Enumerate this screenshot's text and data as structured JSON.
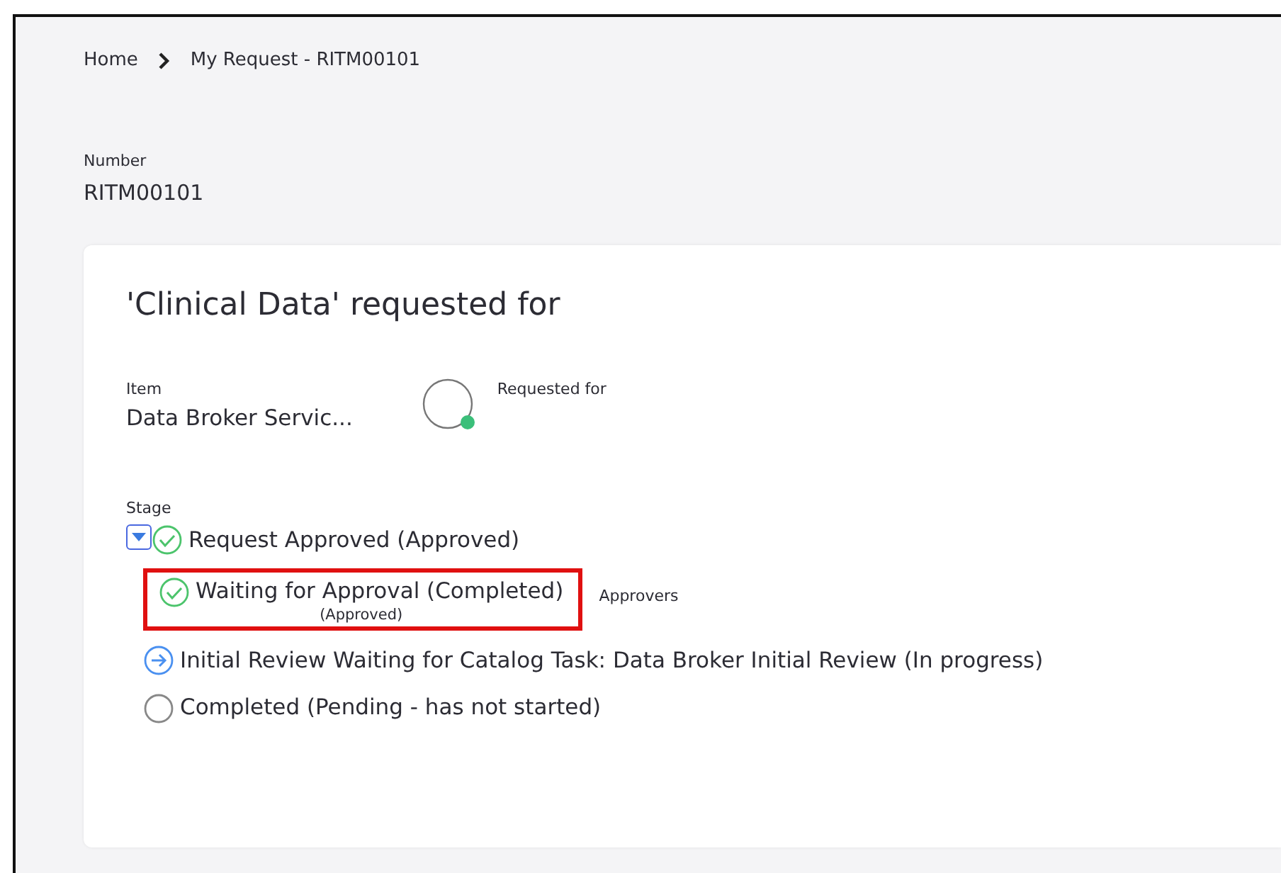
{
  "breadcrumb": [
    {
      "label": "Home"
    },
    {
      "label": "My Request - RITM00101"
    }
  ],
  "number": {
    "label": "Number",
    "value": "RITM00101"
  },
  "card": {
    "title": "'Clinical Data' requested for",
    "item": {
      "label": "Item",
      "value": "Data Broker Servic..."
    },
    "requested_for": {
      "label": "Requested for",
      "online": true
    },
    "stage": {
      "label": "Stage",
      "expanded": true,
      "stages": [
        {
          "kind": "approved",
          "text": "Request Approved (Approved)",
          "highlighted": false
        },
        {
          "kind": "approved",
          "text": "Waiting for Approval (Completed)",
          "subtext": "(Approved)",
          "side_label": "Approvers",
          "highlighted": true
        },
        {
          "kind": "in_progress",
          "text": "Initial Review Waiting for Catalog Task: Data Broker Initial Review (In progress)",
          "highlighted": false
        },
        {
          "kind": "pending",
          "text": "Completed (Pending - has not started)",
          "highlighted": false
        }
      ]
    }
  }
}
